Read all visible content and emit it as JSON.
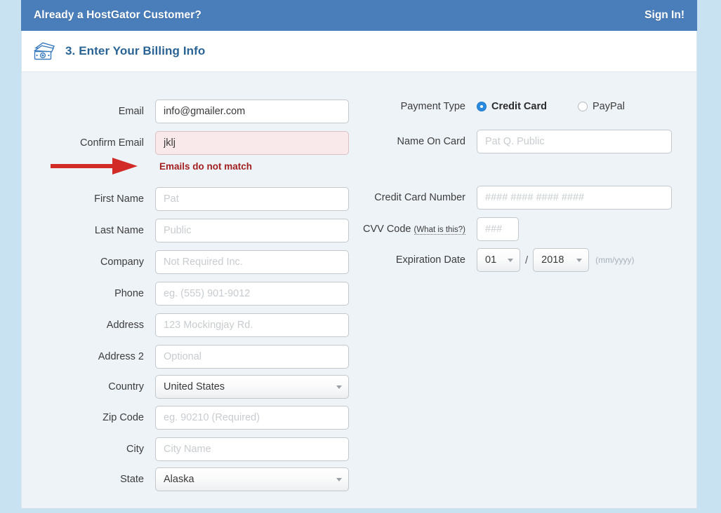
{
  "topbar": {
    "title": "Already a HostGator Customer?",
    "signin_label": "Sign In!",
    "bg_color": "#4a7ebb"
  },
  "step_header": {
    "icon": "money-stack-icon",
    "title": "3. Enter Your Billing Info",
    "title_color": "#2a6496"
  },
  "billing_form": {
    "left_column": {
      "fields": [
        {
          "label": "Email",
          "name": "email",
          "value": "info@gmailer.com",
          "placeholder": "",
          "type": "text"
        },
        {
          "label": "Confirm Email",
          "name": "confirm-email",
          "value": "jklj",
          "placeholder": "",
          "type": "text",
          "error": true
        },
        {
          "label": "First Name",
          "name": "first-name",
          "value": "",
          "placeholder": "Pat",
          "type": "text"
        },
        {
          "label": "Last Name",
          "name": "last-name",
          "value": "",
          "placeholder": "Public",
          "type": "text"
        },
        {
          "label": "Company",
          "name": "company",
          "value": "",
          "placeholder": "Not Required Inc.",
          "type": "text"
        },
        {
          "label": "Phone",
          "name": "phone",
          "value": "",
          "placeholder": "eg. (555) 901-9012",
          "type": "text"
        },
        {
          "label": "Address",
          "name": "address",
          "value": "",
          "placeholder": "123 Mockingjay Rd.",
          "type": "text"
        },
        {
          "label": "Address 2",
          "name": "address-2",
          "value": "",
          "placeholder": "Optional",
          "type": "text"
        },
        {
          "label": "Country",
          "name": "country",
          "value": "United States",
          "type": "select"
        },
        {
          "label": "Zip Code",
          "name": "zip-code",
          "value": "",
          "placeholder": "eg. 90210 (Required)",
          "type": "text"
        },
        {
          "label": "City",
          "name": "city",
          "value": "",
          "placeholder": "City Name",
          "type": "text"
        },
        {
          "label": "State",
          "name": "state",
          "value": "Alaska",
          "type": "select"
        }
      ],
      "error_message": "Emails do not match",
      "error_color": "#a32020"
    },
    "right_column": {
      "payment_type": {
        "label": "Payment Type",
        "options": [
          {
            "label": "Credit Card",
            "selected": true
          },
          {
            "label": "PayPal",
            "selected": false
          }
        ],
        "accent_color": "#2b8ae0"
      },
      "name_on_card": {
        "label": "Name On Card",
        "value": "",
        "placeholder": "Pat Q. Public"
      },
      "card_number": {
        "label": "Credit Card Number",
        "value": "",
        "placeholder": "#### #### #### ####"
      },
      "cvv": {
        "label": "CVV Code",
        "help_link": "(What is this?)",
        "value": "",
        "placeholder": "###"
      },
      "expiration": {
        "label": "Expiration Date",
        "month": "01",
        "year": "2018",
        "separator": "/",
        "format_hint": "(mm/yyyy)"
      }
    }
  },
  "annotation": {
    "type": "red-arrow",
    "color": "#d22a26",
    "points_to": "Emails do not match"
  }
}
